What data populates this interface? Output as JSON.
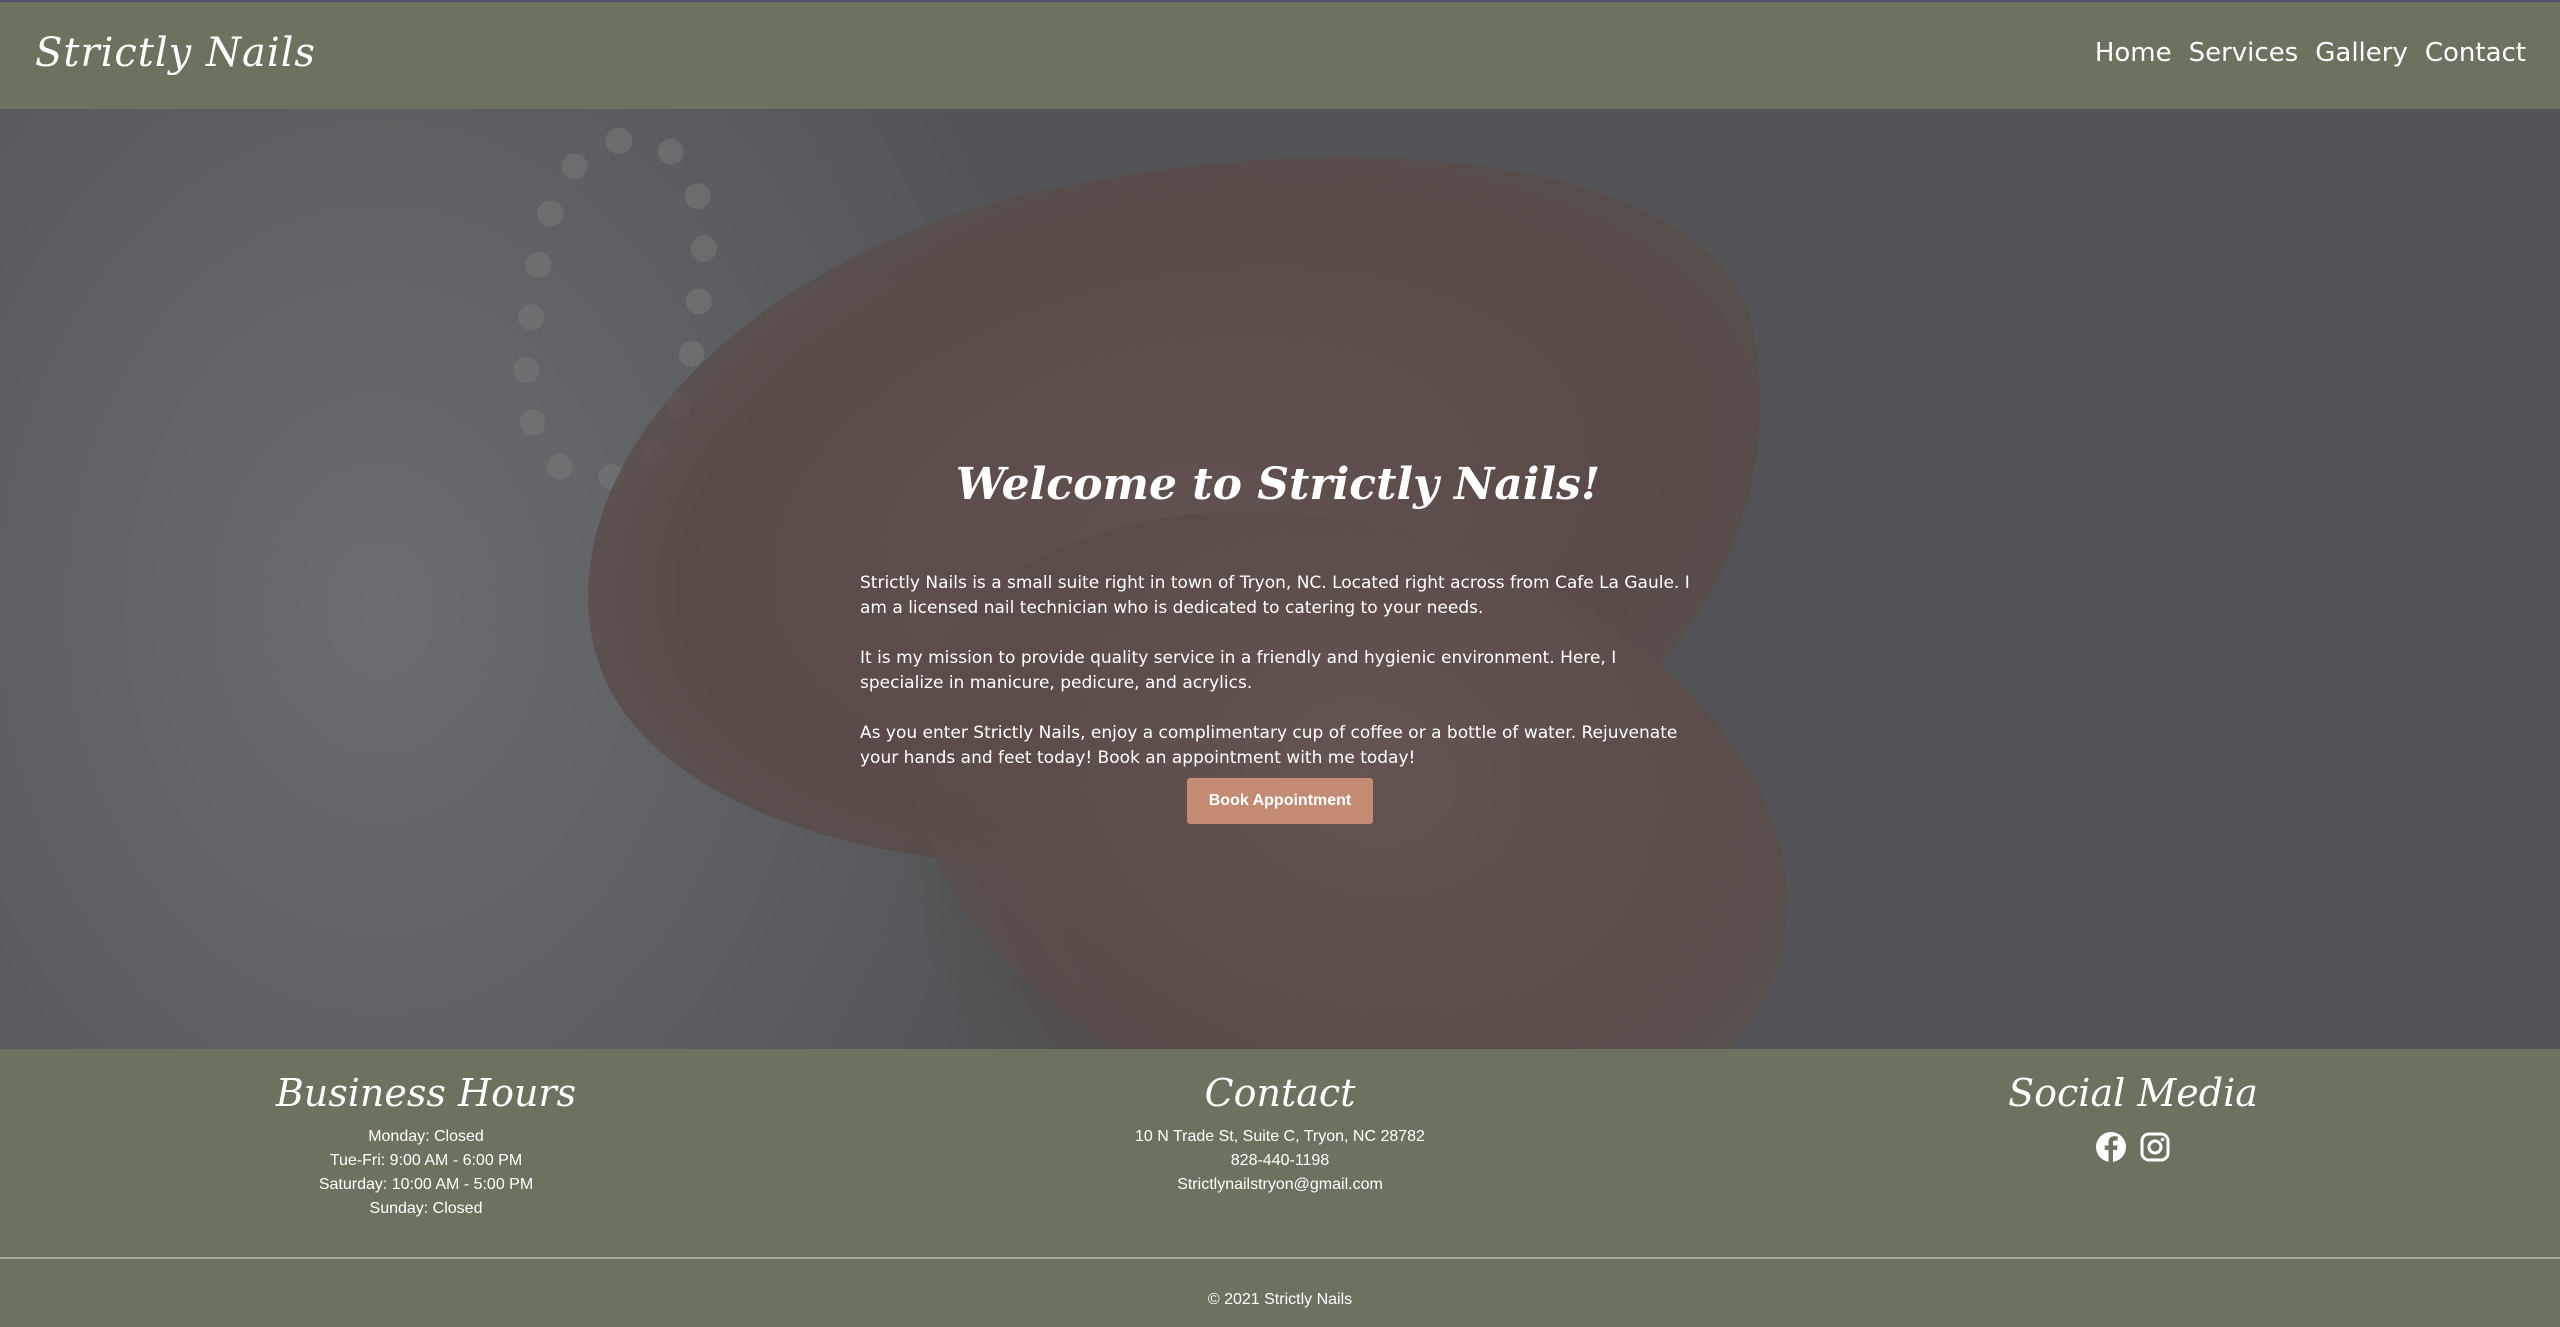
{
  "header": {
    "brand": "Strictly Nails",
    "nav": [
      {
        "label": "Home"
      },
      {
        "label": "Services"
      },
      {
        "label": "Gallery"
      },
      {
        "label": "Contact"
      }
    ]
  },
  "hero": {
    "title": "Welcome to Strictly Nails!",
    "paragraphs": [
      "Strictly Nails is a small suite right in town of Tryon, NC. Located right across from Cafe La Gaule. I am a licensed nail technician who is dedicated to catering to your needs.",
      "It is my mission to provide quality service in a friendly and hygienic environment. Here, I specialize in manicure, pedicure, and acrylics.",
      "As you enter Strictly Nails, enjoy a complimentary cup of coffee or a bottle of water. Rejuvenate your hands and feet today! Book an appointment with me today!"
    ],
    "button_label": "Book Appointment"
  },
  "footer": {
    "hours": {
      "title": "Business Hours",
      "lines": [
        "Monday: Closed",
        "Tue-Fri: 9:00 AM - 6:00 PM",
        "Saturday: 10:00 AM - 5:00 PM",
        "Sunday: Closed"
      ]
    },
    "contact": {
      "title": "Contact",
      "lines": [
        "10 N Trade St, Suite C, Tryon, NC 28782",
        "828-440-1198",
        "Strictlynailstryon@gmail.com"
      ]
    },
    "social": {
      "title": "Social Media",
      "icons": [
        "facebook-icon",
        "instagram-icon"
      ]
    },
    "copyright": "© 2021 Strictly Nails"
  },
  "colors": {
    "header_bg": "#6b7260",
    "button_bg": "#c38b74",
    "text": "#ffffff"
  }
}
